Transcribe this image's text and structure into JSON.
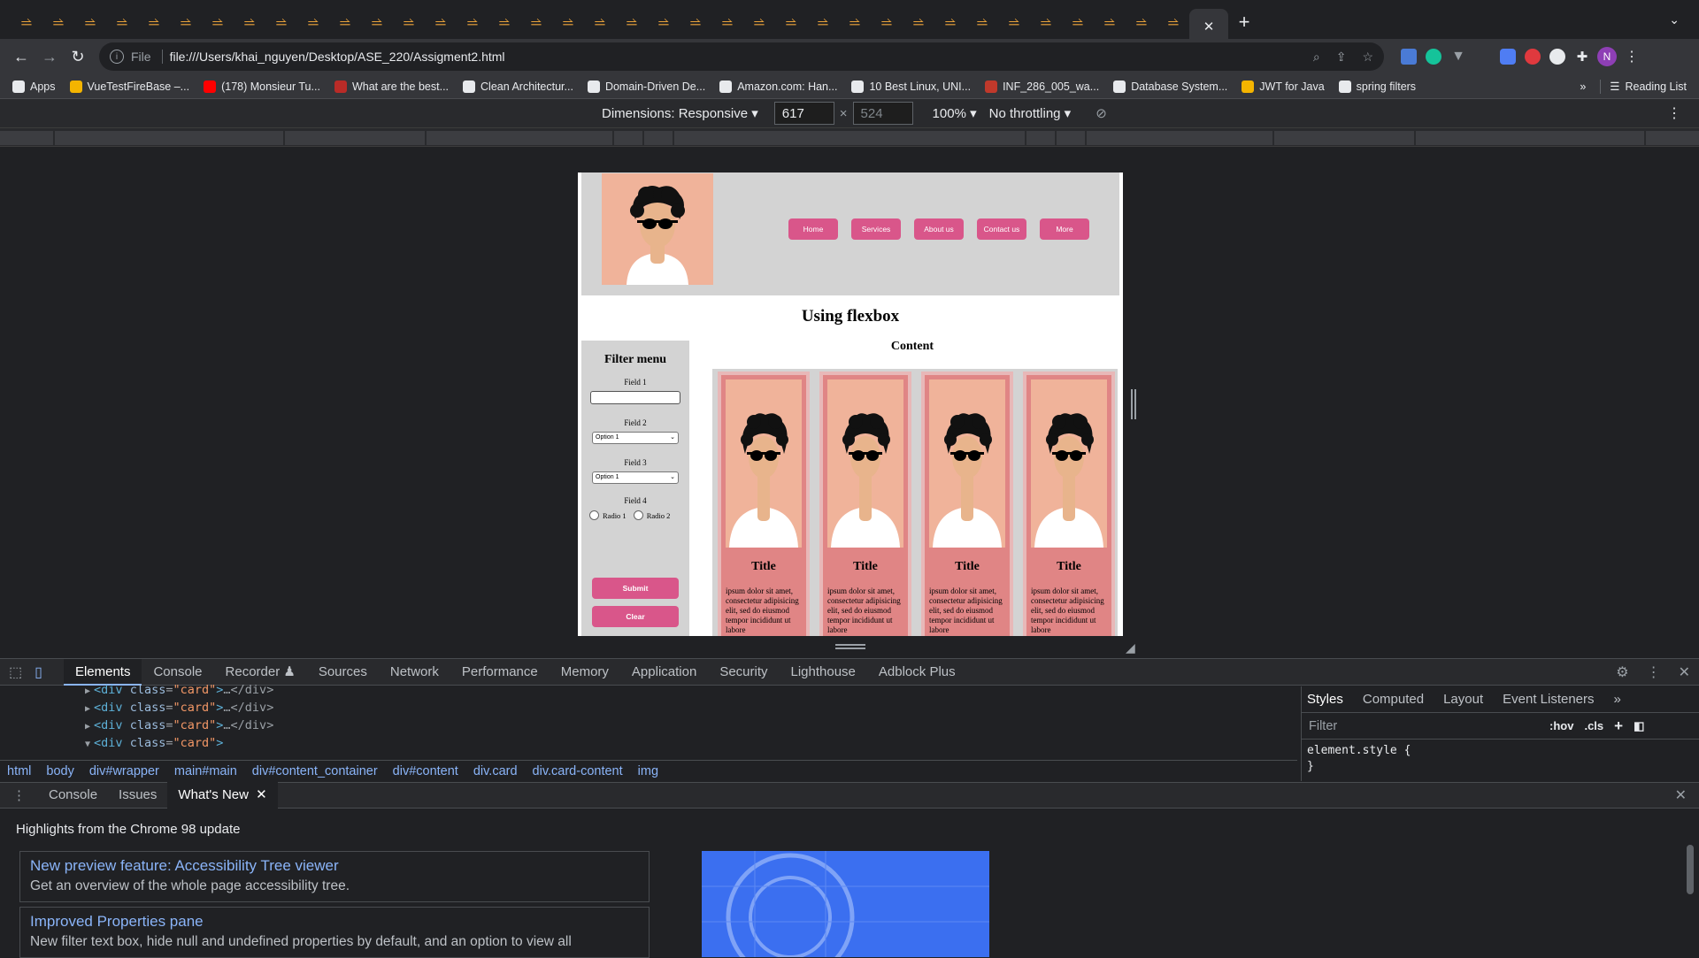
{
  "browser": {
    "tabs_count": 37,
    "active_tab_close": "✕",
    "new_tab": "+",
    "url_scheme": "File",
    "url": "file:///Users/khai_nguyen/Desktop/ASE_220/Assigment2.html",
    "profile_initial": "N"
  },
  "bookmarks": {
    "items": [
      {
        "label": "Apps",
        "color": "#e8eaed"
      },
      {
        "label": "VueTestFireBase –...",
        "color": "#f4b400"
      },
      {
        "label": "(178) Monsieur Tu...",
        "color": "#ff0000"
      },
      {
        "label": "What are the best...",
        "color": "#b92b27"
      },
      {
        "label": "Clean Architectur...",
        "color": "#e8eaed"
      },
      {
        "label": "Domain-Driven De...",
        "color": "#e8eaed"
      },
      {
        "label": "Amazon.com: Han...",
        "color": "#e8eaed"
      },
      {
        "label": "10 Best Linux, UNI...",
        "color": "#e8eaed"
      },
      {
        "label": "INF_286_005_wa...",
        "color": "#c0392b"
      },
      {
        "label": "Database System...",
        "color": "#e8eaed"
      },
      {
        "label": "JWT for Java",
        "color": "#f4b400"
      },
      {
        "label": "spring filters",
        "color": "#e8eaed"
      }
    ],
    "more": "»",
    "reading_list": "Reading List"
  },
  "device_toolbar": {
    "dimensions_label": "Dimensions: Responsive",
    "width": "617",
    "times": "×",
    "height": "524",
    "zoom": "100%",
    "throttling": "No throttling"
  },
  "site": {
    "nav": [
      "Home",
      "Services",
      "About us",
      "Contact us",
      "More"
    ],
    "heading": "Using flexbox",
    "filter": {
      "title": "Filter menu",
      "field1": "Field 1",
      "field2": "Field 2",
      "field2_value": "Option 1",
      "field3": "Field 3",
      "field3_value": "Option 1",
      "field4": "Field 4",
      "radio1": "Radio 1",
      "radio2": "Radio 2",
      "submit": "Submit",
      "clear": "Clear"
    },
    "content_title": "Content",
    "cards": [
      {
        "title": "Title",
        "text": "ipsum dolor sit amet, consectetur adipisicing elit, sed do eiusmod tempor incididunt ut labore"
      },
      {
        "title": "Title",
        "text": "ipsum dolor sit amet, consectetur adipisicing elit, sed do eiusmod tempor incididunt ut labore"
      },
      {
        "title": "Title",
        "text": "ipsum dolor sit amet, consectetur adipisicing elit, sed do eiusmod tempor incididunt ut labore"
      },
      {
        "title": "Title",
        "text": "ipsum dolor sit amet, consectetur adipisicing elit, sed do eiusmod tempor incididunt ut labore"
      }
    ]
  },
  "devtools": {
    "tabs": [
      "Elements",
      "Console",
      "Recorder ♟",
      "Sources",
      "Network",
      "Performance",
      "Memory",
      "Application",
      "Security",
      "Lighthouse",
      "Adblock Plus"
    ],
    "elements_lines": [
      {
        "tri": "▶",
        "tag": "div",
        "attr": "class",
        "val": "card",
        "rest": "…</div>"
      },
      {
        "tri": "▶",
        "tag": "div",
        "attr": "class",
        "val": "card",
        "rest": "…</div>"
      },
      {
        "tri": "▶",
        "tag": "div",
        "attr": "class",
        "val": "card",
        "rest": "…</div>"
      },
      {
        "tri": "▼",
        "tag": "div",
        "attr": "class",
        "val": "card",
        "rest": ""
      }
    ],
    "breadcrumbs": [
      "html",
      "body",
      "div#wrapper",
      "main#main",
      "div#content_container",
      "div#content",
      "div.card",
      "div.card-content",
      "img"
    ],
    "styles_tabs": [
      "Styles",
      "Computed",
      "Layout",
      "Event Listeners",
      "»"
    ],
    "filter_placeholder": "Filter",
    "hov": ":hov",
    "cls": ".cls",
    "code_line1": "element.style {",
    "code_line2": "}",
    "drawer_tabs": [
      "Console",
      "Issues",
      "What's New"
    ],
    "whats_new_heading": "Highlights from the Chrome 98 update",
    "news": [
      {
        "title": "New preview feature: Accessibility Tree viewer",
        "desc": "Get an overview of the whole page accessibility tree."
      },
      {
        "title": "Improved Properties pane",
        "desc": "New filter text box, hide null and undefined properties by default, and an option to view all"
      }
    ]
  },
  "colors": {
    "nav_button": "#d9568a",
    "card_outer": "#e8b8b8",
    "card_inner": "#e08585",
    "accent_link": "#8ab4f8"
  }
}
